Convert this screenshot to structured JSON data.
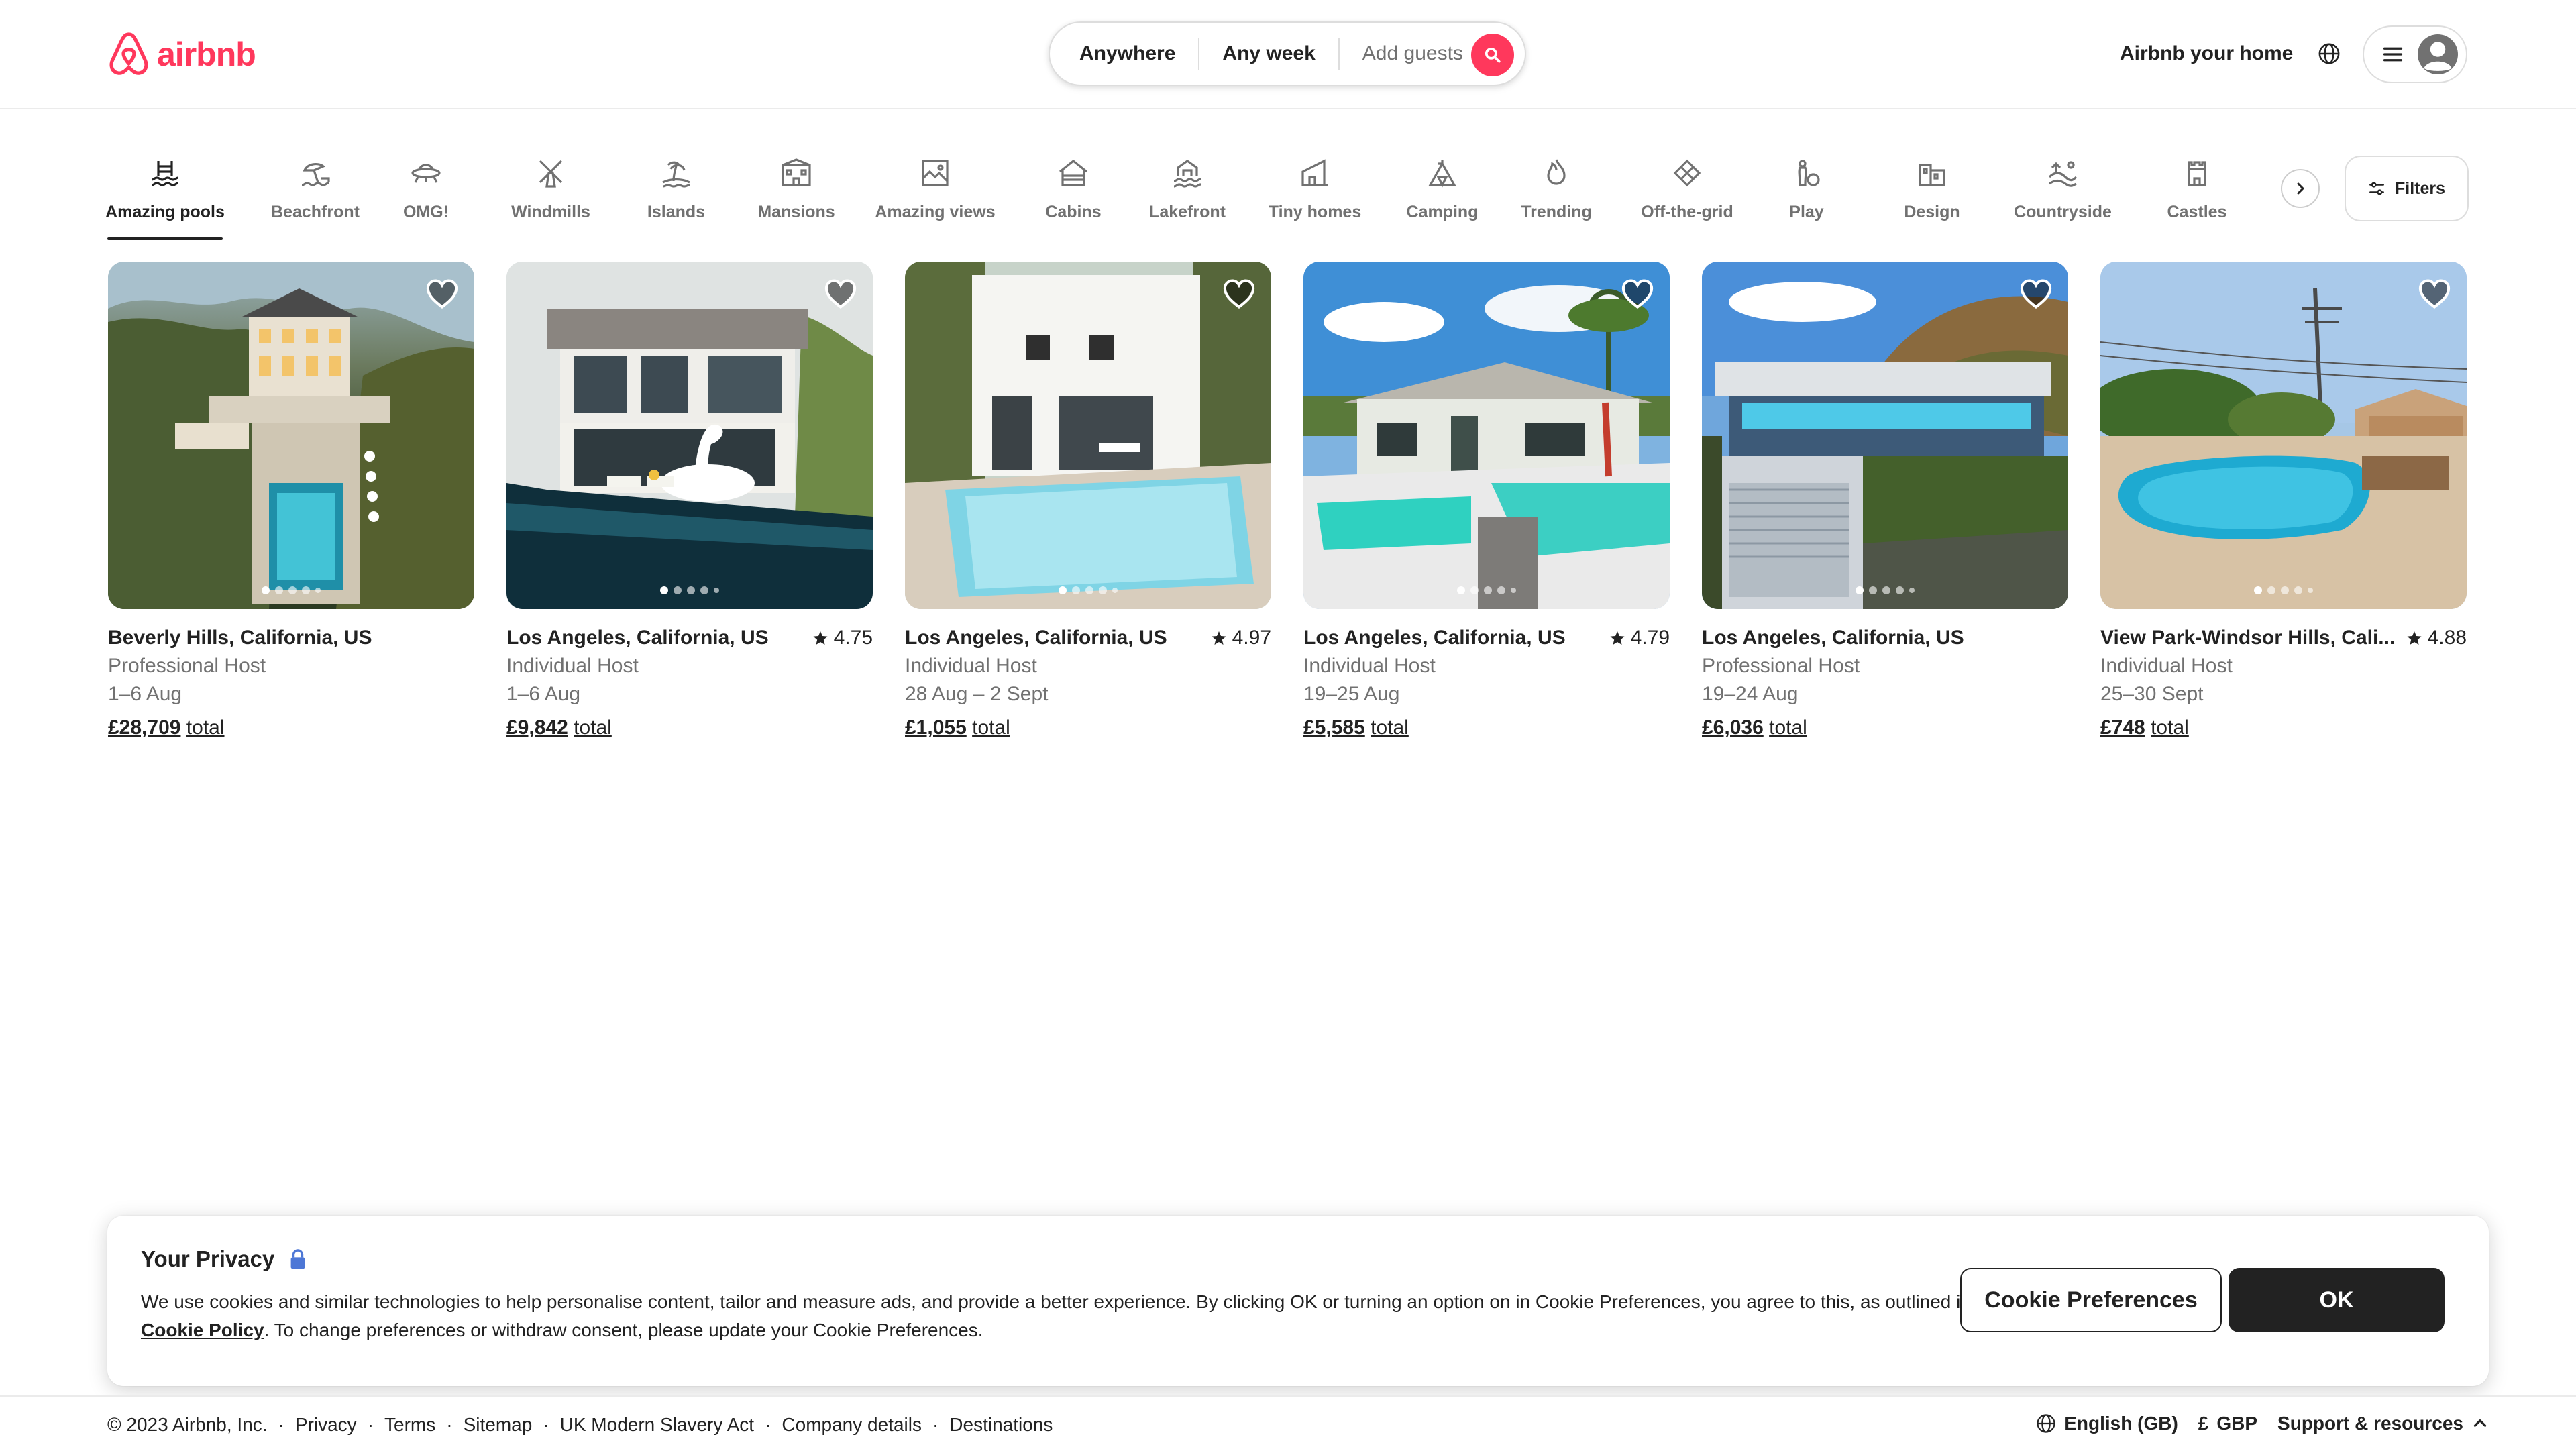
{
  "brand": {
    "name": "airbnb",
    "color": "#FF385C"
  },
  "search": {
    "where": "Anywhere",
    "when": "Any week",
    "guests_placeholder": "Add guests"
  },
  "header": {
    "host_link": "Airbnb your home",
    "icons": [
      "globe-icon",
      "menu-icon",
      "user-avatar-icon"
    ]
  },
  "categories": [
    {
      "label": "Amazing pools",
      "icon": "pool-icon",
      "active": true
    },
    {
      "label": "Beachfront",
      "icon": "beachfront-icon"
    },
    {
      "label": "OMG!",
      "icon": "omg-ufo-icon"
    },
    {
      "label": "Windmills",
      "icon": "windmill-icon"
    },
    {
      "label": "Islands",
      "icon": "island-icon"
    },
    {
      "label": "Mansions",
      "icon": "mansion-icon"
    },
    {
      "label": "Amazing views",
      "icon": "views-icon"
    },
    {
      "label": "Cabins",
      "icon": "cabin-icon"
    },
    {
      "label": "Lakefront",
      "icon": "lakefront-icon"
    },
    {
      "label": "Tiny homes",
      "icon": "tiny-home-icon"
    },
    {
      "label": "Camping",
      "icon": "camping-icon"
    },
    {
      "label": "Trending",
      "icon": "trending-flame-icon"
    },
    {
      "label": "Off-the-grid",
      "icon": "off-the-grid-icon"
    },
    {
      "label": "Play",
      "icon": "play-icon"
    },
    {
      "label": "Design",
      "icon": "design-icon"
    },
    {
      "label": "Countryside",
      "icon": "countryside-icon"
    },
    {
      "label": "Castles",
      "icon": "castle-icon"
    }
  ],
  "filters_label": "Filters",
  "listings": [
    {
      "location": "Beverly Hills, California, US",
      "rating": "",
      "host": "Professional Host",
      "dates": "1–6 Aug",
      "price": "£28,709",
      "total": "total"
    },
    {
      "location": "Los Angeles, California, US",
      "rating": "4.75",
      "host": "Individual Host",
      "dates": "1–6 Aug",
      "price": "£9,842",
      "total": "total"
    },
    {
      "location": "Los Angeles, California, US",
      "rating": "4.97",
      "host": "Individual Host",
      "dates": "28 Aug – 2 Sept",
      "price": "£1,055",
      "total": "total"
    },
    {
      "location": "Los Angeles, California, US",
      "rating": "4.79",
      "host": "Individual Host",
      "dates": "19–25 Aug",
      "price": "£5,585",
      "total": "total"
    },
    {
      "location": "Los Angeles, California, US",
      "rating": "",
      "host": "Professional Host",
      "dates": "19–24 Aug",
      "price": "£6,036",
      "total": "total"
    },
    {
      "location": "View Park-Windsor Hills, Cali...",
      "rating": "4.88",
      "host": "Individual Host",
      "dates": "25–30 Sept",
      "price": "£748",
      "total": "total"
    }
  ],
  "privacy": {
    "title": "Your Privacy",
    "text_before": "We use cookies and similar technologies to help personalise content, tailor and measure ads, and provide a better experience. By clicking OK or turning an option on in Cookie Preferences, you agree to this, as outlined in our ",
    "policy_link": "Cookie Policy",
    "text_after": ". To change preferences or withdraw consent, please update your Cookie Preferences.",
    "prefs_button": "Cookie Preferences",
    "ok_button": "OK"
  },
  "footer": {
    "copyright": "© 2023 Airbnb, Inc.",
    "links": [
      "Privacy",
      "Terms",
      "Sitemap",
      "UK Modern Slavery Act",
      "Company details",
      "Destinations"
    ],
    "language": "English (GB)",
    "currency_symbol": "£",
    "currency": "GBP",
    "support": "Support & resources"
  }
}
